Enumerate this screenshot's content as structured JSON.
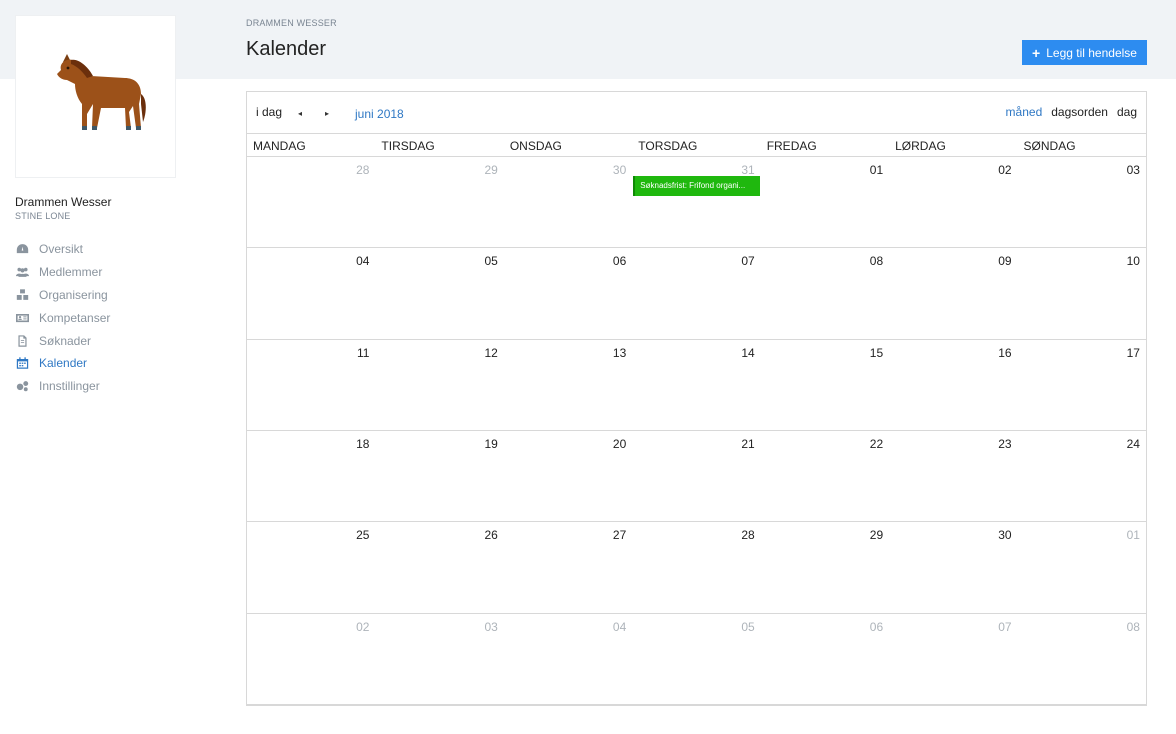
{
  "sidebar": {
    "org_name": "Drammen Wesser",
    "user_name": "STINE LONE",
    "nav": [
      {
        "label": "Oversikt",
        "icon": "dashboard-icon",
        "active": false
      },
      {
        "label": "Medlemmer",
        "icon": "users-icon",
        "active": false
      },
      {
        "label": "Organisering",
        "icon": "cubes-icon",
        "active": false
      },
      {
        "label": "Kompetanser",
        "icon": "id-card-icon",
        "active": false
      },
      {
        "label": "Søknader",
        "icon": "file-icon",
        "active": false
      },
      {
        "label": "Kalender",
        "icon": "calendar-icon",
        "active": true
      },
      {
        "label": "Innstillinger",
        "icon": "gears-icon",
        "active": false
      }
    ]
  },
  "header": {
    "breadcrumb": "DRAMMEN WESSER",
    "title": "Kalender",
    "add_button": "Legg til hendelse"
  },
  "calendar": {
    "today_label": "i dag",
    "prev_glyph": "◂",
    "next_glyph": "▸",
    "month_label": "juni 2018",
    "views": [
      {
        "label": "måned",
        "active": true
      },
      {
        "label": "dagsorden",
        "active": false
      },
      {
        "label": "dag",
        "active": false
      }
    ],
    "day_headers": [
      "Mandag",
      "Tirsdag",
      "Onsdag",
      "Torsdag",
      "Fredag",
      "Lørdag",
      "Søndag"
    ],
    "weeks": [
      [
        {
          "n": "28",
          "other": true
        },
        {
          "n": "29",
          "other": true
        },
        {
          "n": "30",
          "other": true
        },
        {
          "n": "31",
          "other": true
        },
        {
          "n": "01",
          "other": false
        },
        {
          "n": "02",
          "other": false
        },
        {
          "n": "03",
          "other": false
        }
      ],
      [
        {
          "n": "04",
          "other": false
        },
        {
          "n": "05",
          "other": false
        },
        {
          "n": "06",
          "other": false
        },
        {
          "n": "07",
          "other": false
        },
        {
          "n": "08",
          "other": false
        },
        {
          "n": "09",
          "other": false
        },
        {
          "n": "10",
          "other": false
        }
      ],
      [
        {
          "n": "11",
          "other": false
        },
        {
          "n": "12",
          "other": false
        },
        {
          "n": "13",
          "other": false
        },
        {
          "n": "14",
          "other": false
        },
        {
          "n": "15",
          "other": false
        },
        {
          "n": "16",
          "other": false
        },
        {
          "n": "17",
          "other": false
        }
      ],
      [
        {
          "n": "18",
          "other": false
        },
        {
          "n": "19",
          "other": false
        },
        {
          "n": "20",
          "other": false
        },
        {
          "n": "21",
          "other": false
        },
        {
          "n": "22",
          "other": false
        },
        {
          "n": "23",
          "other": false
        },
        {
          "n": "24",
          "other": false
        }
      ],
      [
        {
          "n": "25",
          "other": false
        },
        {
          "n": "26",
          "other": false
        },
        {
          "n": "27",
          "other": false
        },
        {
          "n": "28",
          "other": false
        },
        {
          "n": "29",
          "other": false
        },
        {
          "n": "30",
          "other": false
        },
        {
          "n": "01",
          "other": true
        }
      ],
      [
        {
          "n": "02",
          "other": true
        },
        {
          "n": "03",
          "other": true
        },
        {
          "n": "04",
          "other": true
        },
        {
          "n": "05",
          "other": true
        },
        {
          "n": "06",
          "other": true
        },
        {
          "n": "07",
          "other": true
        },
        {
          "n": "08",
          "other": true
        }
      ]
    ],
    "events": [
      {
        "title": "Søknadsfrist: Frifond organi...",
        "week": 0,
        "day": 3,
        "color": "#1fb80e"
      }
    ]
  }
}
